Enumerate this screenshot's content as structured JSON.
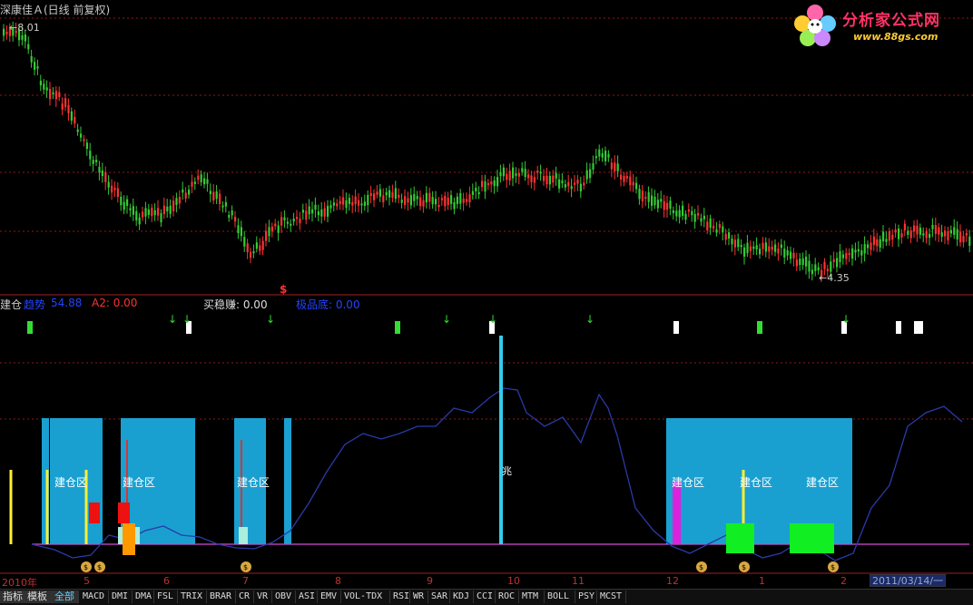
{
  "window": {
    "title": "深康佳Ａ(日线 前复权)"
  },
  "logo": {
    "name": "分析家公式网",
    "url": "www.88gs.com"
  },
  "price_panel": {
    "high_label": "8.01",
    "low_label": "4.35",
    "marker": "$"
  },
  "indicator": {
    "name": "建仓",
    "trend_label": "趋势",
    "trend_value": "54.88",
    "a2_label": "A2: 0.00",
    "buy_label": "买稳赚: 0.00",
    "bottom_label": "极品底: 0.00"
  },
  "zones": {
    "label": "建仓区",
    "signal_char": "兆"
  },
  "x_axis": {
    "labels": [
      "2010年",
      "5",
      "6",
      "7",
      "8",
      "9",
      "10",
      "11",
      "12",
      "1",
      "2"
    ],
    "current_date": "2011/03/14/一"
  },
  "tabs": {
    "side": [
      "指标",
      "模板",
      "全部"
    ],
    "indicators": [
      "MACD",
      "DMI",
      "DMA",
      "FSL",
      "TRIX",
      "BRAR",
      "CR",
      "VR",
      "OBV",
      "ASI",
      "EMV",
      "VOL-TDX",
      "RSI",
      "WR",
      "SAR",
      "KDJ",
      "CCI",
      "ROC",
      "MTM",
      "BOLL",
      "PSY",
      "MCST"
    ]
  },
  "colors": {
    "up_candle": "#ff3232",
    "down_candle": "#33cc33",
    "zone_fill": "#1aa0d0",
    "trend_line": "#2a3aa8",
    "baseline": "#b040b0",
    "grid": "#8b1a1a"
  }
}
